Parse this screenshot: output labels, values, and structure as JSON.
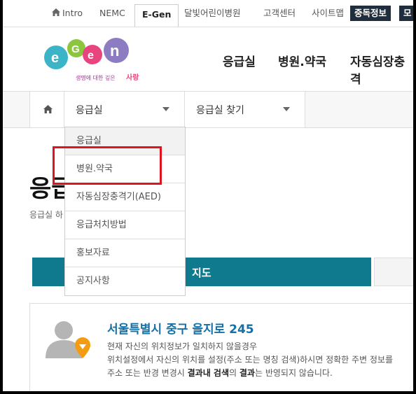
{
  "topbar": {
    "links": [
      "Intro",
      "NEMC",
      "E-Gen",
      "달빛어린이병원",
      "고객센터",
      "사이트맵",
      "중독정보",
      "모"
    ]
  },
  "logo": {
    "letters": [
      "e",
      "G",
      "e",
      "n"
    ],
    "tagline_a": "생명에 대한 깊은",
    "tagline_b": "사랑"
  },
  "mainnav": [
    "응급실",
    "병원.약국",
    "자동심장충격"
  ],
  "subbar": {
    "select1": "응급실",
    "select2": "응급실 찾기"
  },
  "dropdown": {
    "items": [
      "응급실",
      "병원.약국",
      "자동심장충격기(AED)",
      "응급처치방법",
      "홍보자료",
      "공지사항"
    ]
  },
  "page": {
    "title": "응급",
    "subtitle": "응급실 하"
  },
  "tabs": {
    "map": "지도"
  },
  "location": {
    "address": "서울특별시 중구 을지로 245",
    "line1": "현재 자신의 위치정보가 일치하지 않을경우",
    "line2": "위치설정에서 자신의 위치를 설정(주소 또는 명칭 검색)하시면 정확한 주변 정보를",
    "line3_pre": "주소 또는 반경 변경시 ",
    "line3_bold1": "결과내 검색",
    "line3_mid": "의 ",
    "line3_bold2": "결과",
    "line3_post": "는 반영되지 않습니다."
  },
  "colors": {
    "accent_teal": "#0f7a8e",
    "link_blue": "#1570a6",
    "highlight_red": "#e0141e",
    "pin_orange": "#f39c12"
  }
}
